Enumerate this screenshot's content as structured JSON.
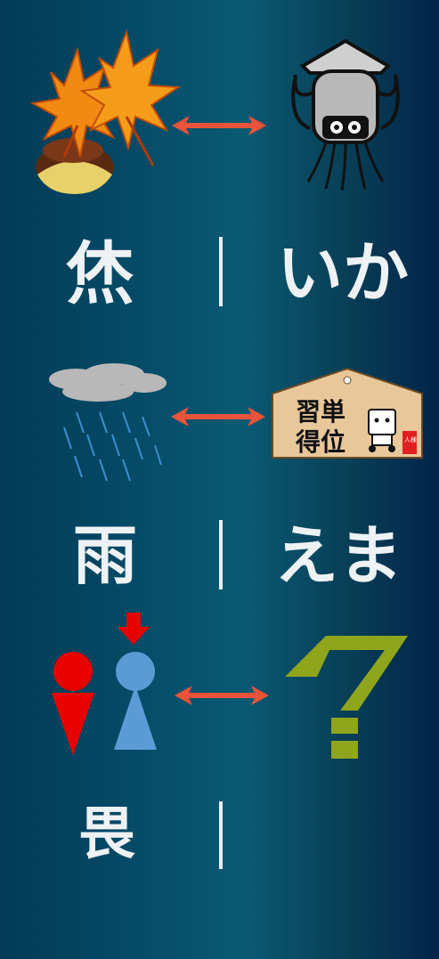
{
  "rows": [
    {
      "left_word": "烋",
      "right_word": "いか",
      "left_icon": "autumn-maple-chestnut-icon",
      "right_icon": "squid-icon"
    },
    {
      "left_word": "雨",
      "right_word": "えま",
      "left_icon": "rain-cloud-icon",
      "right_icon": "ema-plaque-icon"
    },
    {
      "left_word": "畏",
      "right_word": "",
      "left_icon": "man-woman-figures-icon",
      "right_icon": "question-mark-icon"
    }
  ],
  "ema": {
    "line1": "習単",
    "line2": "得位",
    "seal": "人様"
  },
  "colors": {
    "arrow": "#e8533a",
    "question": "#8ea51c",
    "man": "#e60000",
    "woman": "#5b9bd5",
    "pointer": "#e60000"
  }
}
